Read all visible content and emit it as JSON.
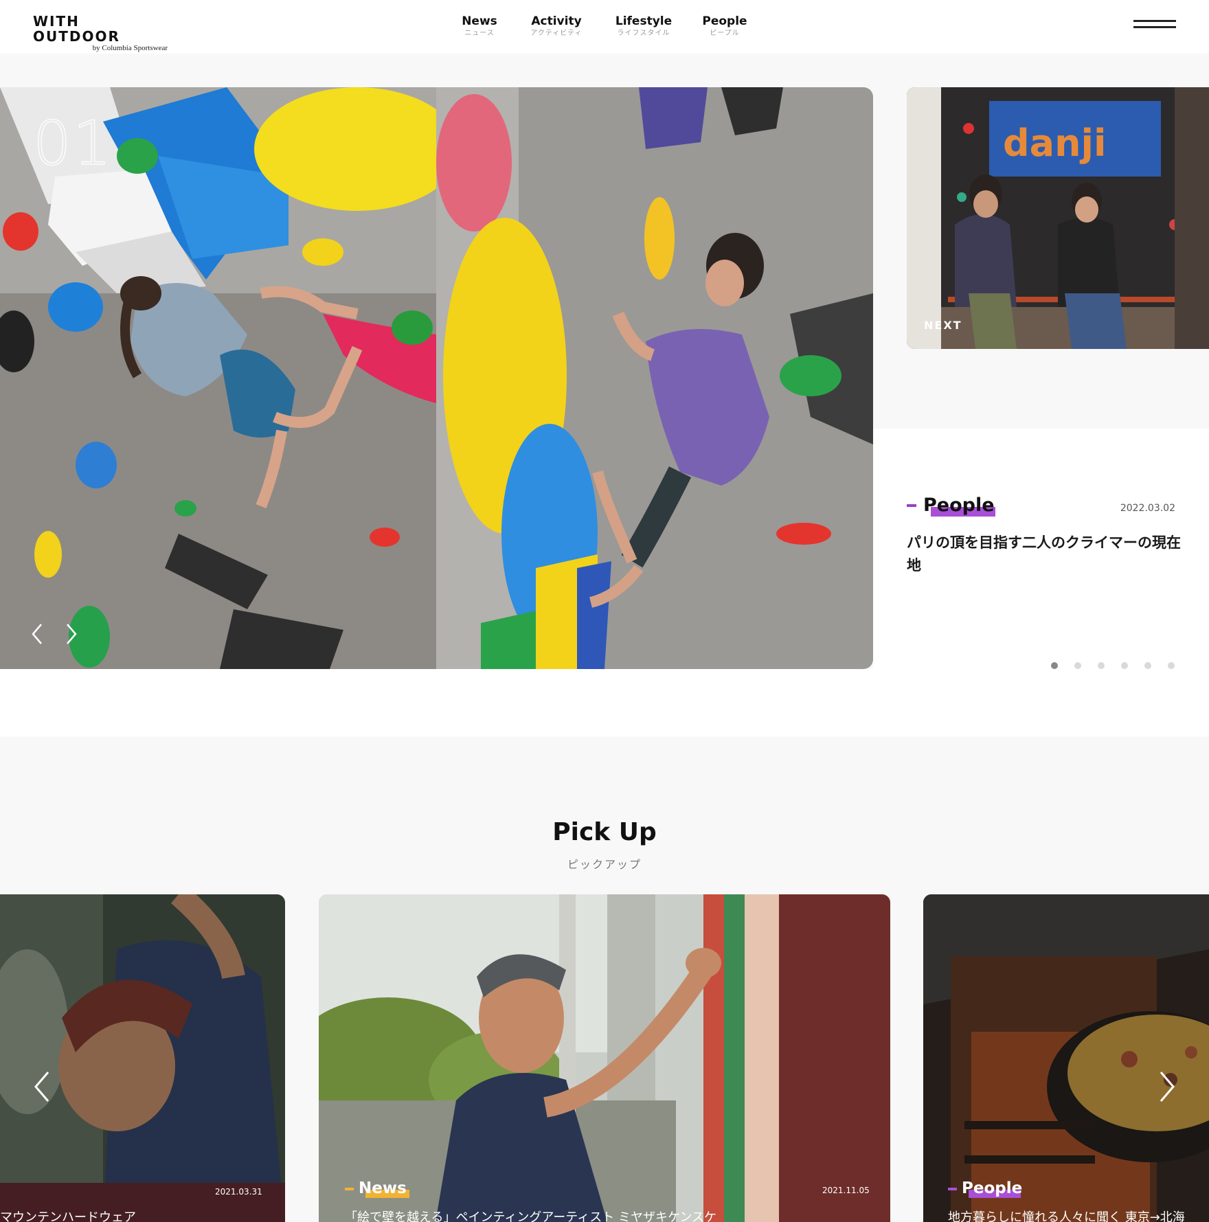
{
  "header": {
    "logo_main": "WITH OUTDOOR",
    "logo_sub": "by Columbia Sportswear",
    "nav": [
      {
        "en": "News",
        "ja": "ニュース"
      },
      {
        "en": "Activity",
        "ja": "アクティビティ"
      },
      {
        "en": "Lifestyle",
        "ja": "ライフスタイル"
      },
      {
        "en": "People",
        "ja": "ピープル"
      }
    ],
    "menu_icon": "hamburger-menu-icon"
  },
  "hero": {
    "number": "01",
    "next_label": "NEXT",
    "category": "People",
    "date": "2022.03.02",
    "title": "パリの頂を目指す二人のクライマーの現在地",
    "slide_count": 6,
    "active_slide": 1,
    "category_color": "#a84fd6"
  },
  "pickup": {
    "title": "Pick Up",
    "subtitle": "ピックアップ",
    "cards": [
      {
        "category": "",
        "date": "2021.03.31",
        "title": "マウンテンハードウェア"
      },
      {
        "category": "News",
        "date": "2021.11.05",
        "title": "「絵で壁を越える」ペインティングアーティスト ミヤザキケンスケ",
        "category_color": "#f2b233"
      },
      {
        "category": "People",
        "date": "",
        "title": "地方暮らしに憧れる人々に聞く 東京→北海",
        "category_color": "#a84fd6"
      }
    ]
  }
}
